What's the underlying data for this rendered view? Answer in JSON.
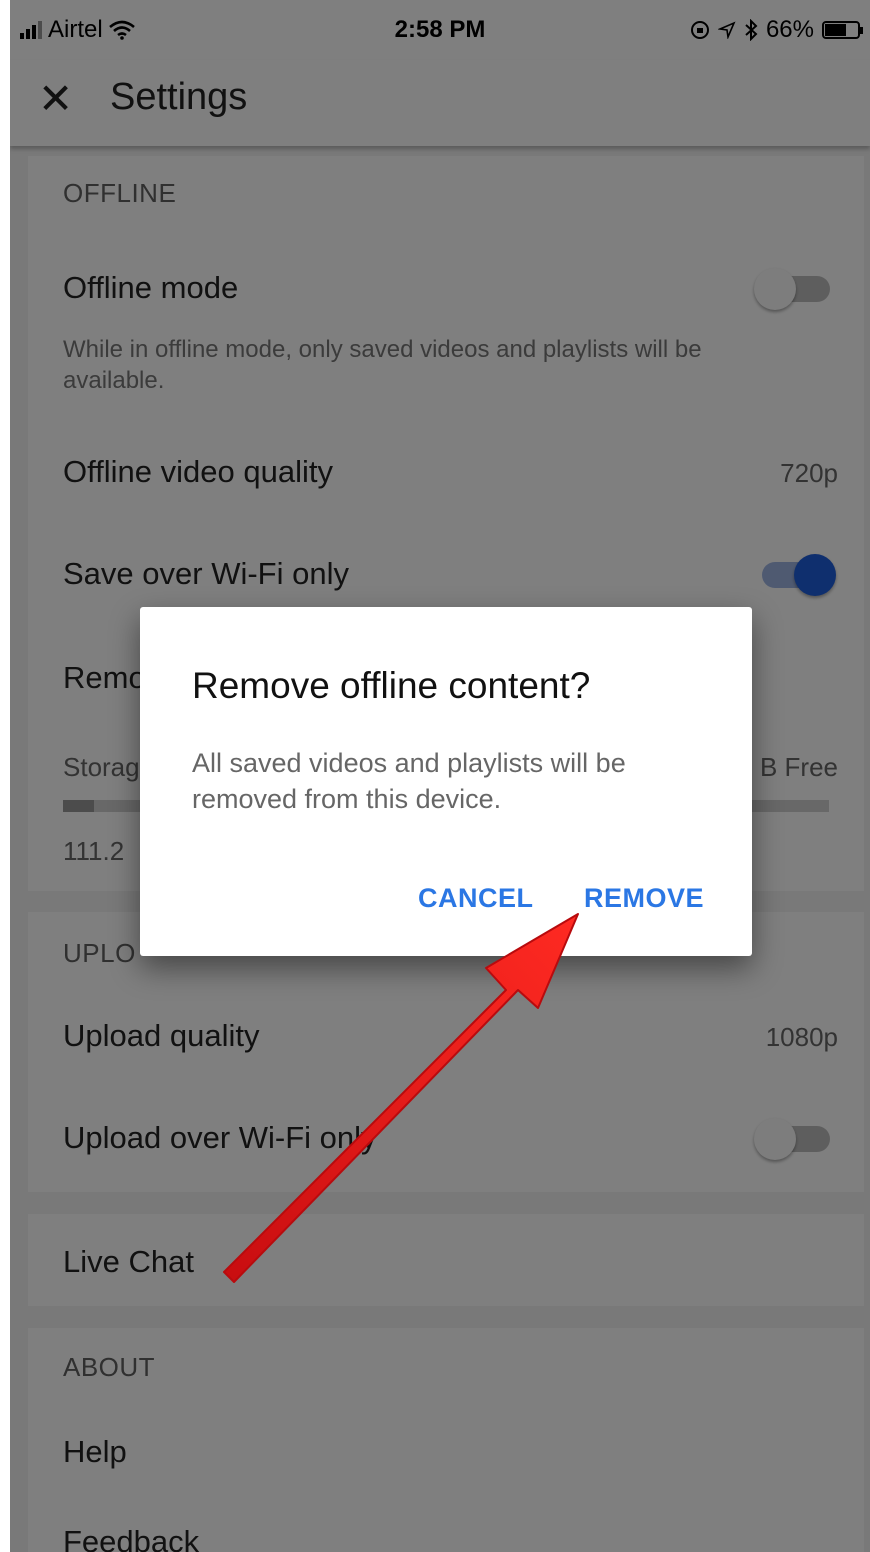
{
  "status": {
    "carrier": "Airtel",
    "time": "2:58 PM",
    "battery": "66%",
    "battery_level": 0.66
  },
  "app_bar": {
    "title": "Settings",
    "close_glyph": "✕"
  },
  "offline": {
    "heading": "OFFLINE",
    "mode_label": "Offline mode",
    "mode_on": false,
    "mode_description": "While in offline mode, only saved videos and playlists will be available.",
    "quality_label": "Offline video quality",
    "quality_value": "720p",
    "wifi_label": "Save over Wi-Fi only",
    "wifi_on": true,
    "remove_label_partial": "Remo",
    "storage_label_partial": "Storag",
    "storage_free_partial": "B Free",
    "storage_used_partial": "111.2"
  },
  "uploads": {
    "heading_partial": "UPLO",
    "quality_label": "Upload quality",
    "quality_value": "1080p",
    "wifi_label": "Upload over Wi-Fi only",
    "wifi_on": false
  },
  "live_chat": {
    "label": "Live Chat"
  },
  "about": {
    "heading": "ABOUT",
    "help_label": "Help",
    "feedback_label": "Feedback"
  },
  "dialog": {
    "title": "Remove offline content?",
    "body": "All saved videos and playlists will be removed from this device.",
    "cancel_label": "CANCEL",
    "remove_label": "REMOVE"
  },
  "colors": {
    "accent": "#2b77e4",
    "toggle_on": "#1f5fdc",
    "annotation_arrow": "#e8141a"
  }
}
